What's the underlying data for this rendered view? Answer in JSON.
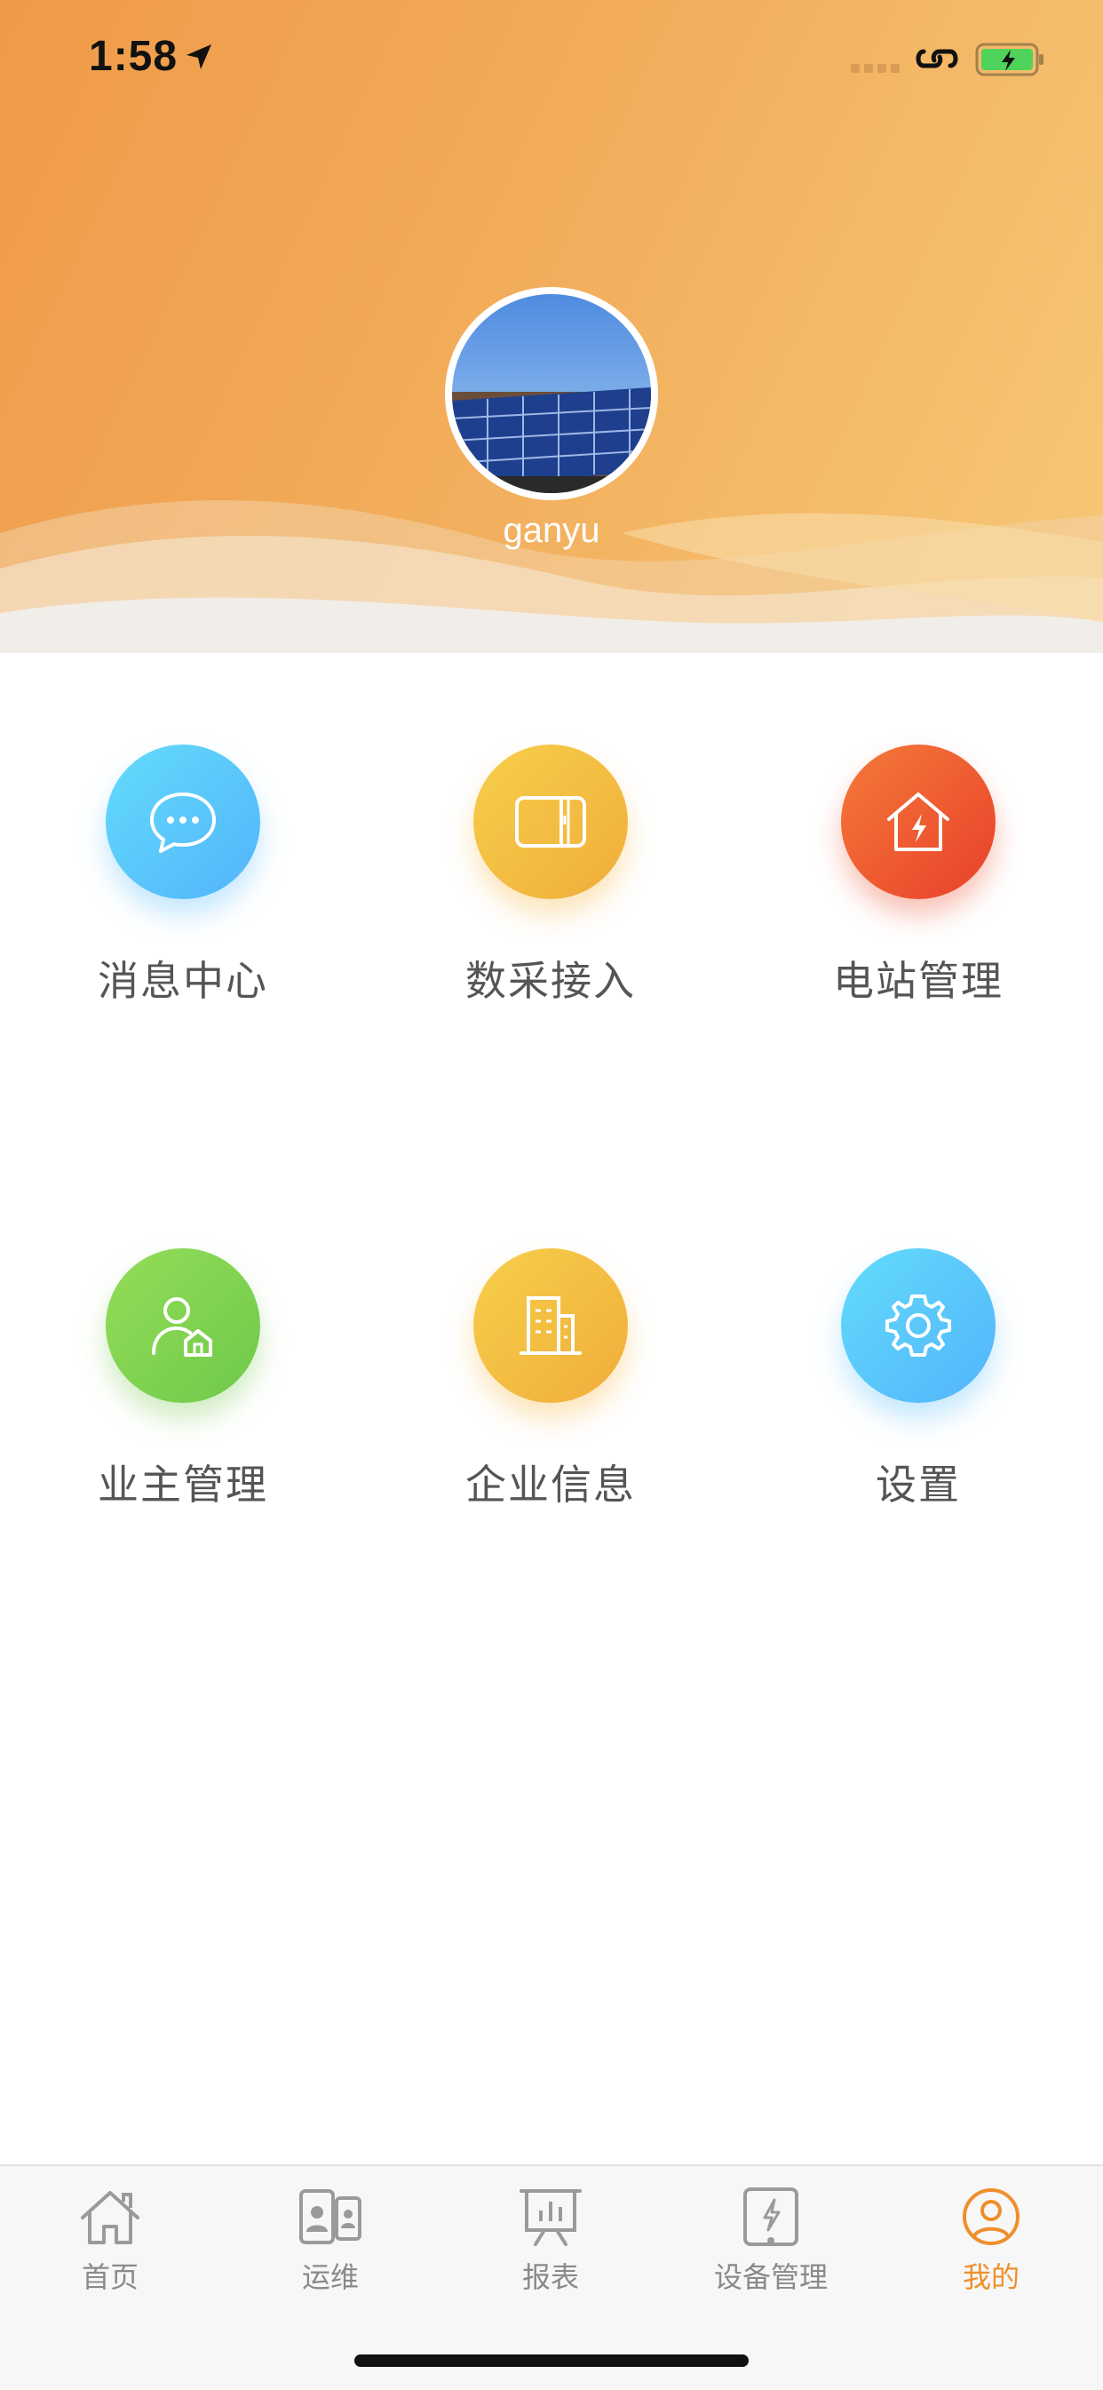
{
  "status_bar": {
    "time": "1:58"
  },
  "profile": {
    "username": "ganyu"
  },
  "menu": [
    {
      "label": "消息中心",
      "icon": "chat-bubble-icon"
    },
    {
      "label": "数采接入",
      "icon": "device-icon"
    },
    {
      "label": "电站管理",
      "icon": "house-lightning-icon"
    },
    {
      "label": "业主管理",
      "icon": "user-home-icon"
    },
    {
      "label": "企业信息",
      "icon": "building-icon"
    },
    {
      "label": "设置",
      "icon": "gear-icon"
    }
  ],
  "tabbar": {
    "items": [
      {
        "label": "首页",
        "icon": "home-icon",
        "active": false
      },
      {
        "label": "运维",
        "icon": "contacts-icon",
        "active": false
      },
      {
        "label": "报表",
        "icon": "report-board-icon",
        "active": false
      },
      {
        "label": "设备管理",
        "icon": "device-lightning-icon",
        "active": false
      },
      {
        "label": "我的",
        "icon": "user-circle-icon",
        "active": true
      }
    ]
  },
  "colors": {
    "accent": "#ef8f2c",
    "header_start": "#ef9a48",
    "header_end": "#f6c877"
  }
}
